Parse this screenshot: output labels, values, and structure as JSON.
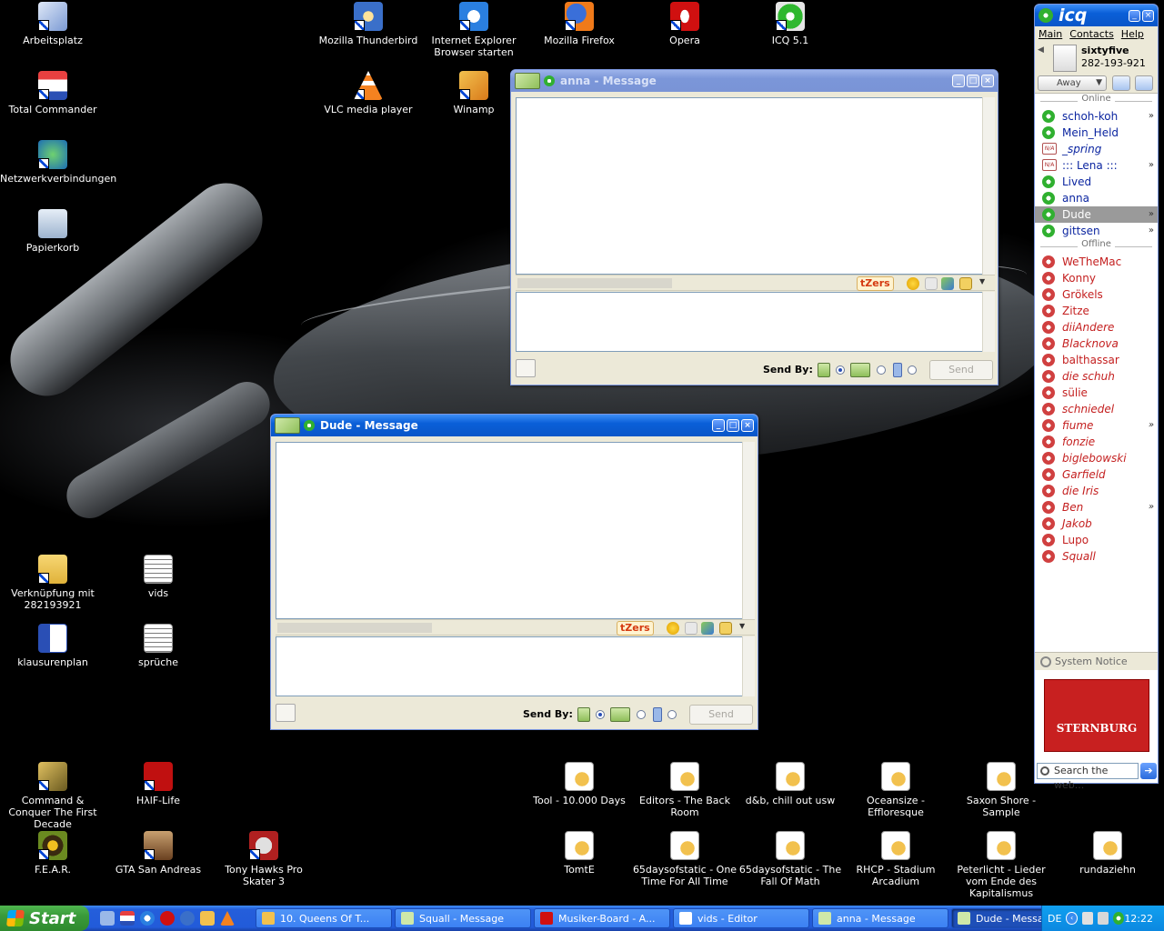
{
  "desktop": {
    "icons": [
      {
        "label": "Arbeitsplatz",
        "cls": "i-pc"
      },
      {
        "label": "Total Commander",
        "cls": "i-tc"
      },
      {
        "label": "Netzwerkverbindungen",
        "cls": "i-net"
      },
      {
        "label": "Papierkorb",
        "cls": "i-bin"
      },
      {
        "label": "Mozilla Thunderbird",
        "cls": "i-tb"
      },
      {
        "label": "Internet Explorer Browser starten",
        "cls": "i-ie"
      },
      {
        "label": "Mozilla Firefox",
        "cls": "i-ff"
      },
      {
        "label": "Opera",
        "cls": "i-op"
      },
      {
        "label": "ICQ 5.1",
        "cls": "i-icq"
      },
      {
        "label": "VLC media player",
        "cls": "i-vlc"
      },
      {
        "label": "Winamp",
        "cls": "i-wa"
      },
      {
        "label": "Verknüpfung mit 282193921",
        "cls": "i-fold"
      },
      {
        "label": "vids",
        "cls": "i-txt"
      },
      {
        "label": "klausurenplan",
        "cls": "i-word"
      },
      {
        "label": "sprüche",
        "cls": "i-txt"
      },
      {
        "label": "Command & Conquer The First Decade",
        "cls": "i-cnc"
      },
      {
        "label": "HλlF-Life",
        "cls": "i-hl"
      },
      {
        "label": "F.E.A.R.",
        "cls": "i-fear"
      },
      {
        "label": "GTA San Andreas",
        "cls": "i-gta"
      },
      {
        "label": "Tony Hawks Pro Skater 3",
        "cls": "i-thps"
      },
      {
        "label": "Tool - 10.000 Days",
        "cls": "i-mp3"
      },
      {
        "label": "Editors - The Back Room",
        "cls": "i-mp3"
      },
      {
        "label": "d&b, chill out usw",
        "cls": "i-mp3"
      },
      {
        "label": "Oceansize - Effloresque",
        "cls": "i-mp3"
      },
      {
        "label": "Saxon Shore - Sample",
        "cls": "i-mp3"
      },
      {
        "label": "TomtE",
        "cls": "i-mp3"
      },
      {
        "label": "65daysofstatic - One Time For All Time",
        "cls": "i-mp3"
      },
      {
        "label": "65daysofstatic - The Fall Of Math",
        "cls": "i-mp3"
      },
      {
        "label": "RHCP - Stadium Arcadium",
        "cls": "i-mp3"
      },
      {
        "label": "Peterlicht - Lieder vom Ende des Kapitalismus",
        "cls": "i-mp3"
      },
      {
        "label": "rundaziehn",
        "cls": "i-mp3"
      }
    ]
  },
  "anna_window": {
    "title": "anna - Message",
    "tzers_label": "tZers",
    "send_by_label": "Send By:",
    "send_label": "Send"
  },
  "dude_window": {
    "title": "Dude - Message",
    "tzers_label": "tZers",
    "send_by_label": "Send By:",
    "send_label": "Send"
  },
  "icq": {
    "title": "icq",
    "menu": {
      "main": "Main",
      "contacts": "Contacts",
      "help": "Help"
    },
    "profile": {
      "name": "sixtyfive",
      "number": "282-193-921"
    },
    "status_label": "Away",
    "online_header": "Online",
    "offline_header": "Offline",
    "online": [
      {
        "name": "schoh-koh",
        "more": true
      },
      {
        "name": "Mein_Held"
      },
      {
        "name": "_spring",
        "na": true,
        "italic": true
      },
      {
        "name": "::: Lena :::",
        "na": true,
        "more": true
      },
      {
        "name": "Lived"
      },
      {
        "name": "anna"
      },
      {
        "name": "Dude",
        "selected": true,
        "more": true
      },
      {
        "name": "gittsen",
        "more": true
      }
    ],
    "offline": [
      {
        "name": "WeTheMac"
      },
      {
        "name": "Konny"
      },
      {
        "name": "Grökels"
      },
      {
        "name": "Zitze"
      },
      {
        "name": "diiAndere",
        "italic": true
      },
      {
        "name": "Blacknova",
        "italic": true
      },
      {
        "name": "balthassar"
      },
      {
        "name": "die schuh",
        "italic": true
      },
      {
        "name": "sülie"
      },
      {
        "name": "schniedel",
        "italic": true
      },
      {
        "name": "fiume",
        "italic": true,
        "more": true
      },
      {
        "name": "fonzie",
        "italic": true
      },
      {
        "name": "biglebowski",
        "italic": true
      },
      {
        "name": "Garfield",
        "italic": true
      },
      {
        "name": "die Iris",
        "italic": true
      },
      {
        "name": "Ben",
        "italic": true,
        "more": true
      },
      {
        "name": "Jakob",
        "italic": true
      },
      {
        "name": "Lupo"
      },
      {
        "name": "Squall",
        "italic": true
      }
    ],
    "system_notice": "System Notice",
    "ad_text": "STERNBURG",
    "search_placeholder": "Search the web..."
  },
  "taskbar": {
    "start_label": "Start",
    "tasks": [
      {
        "label": "10. Queens Of T...",
        "icon": "#f2c14e",
        "active": false
      },
      {
        "label": "Squall - Message",
        "icon": "#cfe8a8",
        "active": false
      },
      {
        "label": "Musiker-Board - A...",
        "icon": "#d01010",
        "active": false
      },
      {
        "label": "vids - Editor",
        "icon": "#ffffff",
        "active": false
      },
      {
        "label": "anna - Message",
        "icon": "#cfe8a8",
        "active": false
      },
      {
        "label": "Dude - Message",
        "icon": "#cfe8a8",
        "active": true
      }
    ],
    "tray": {
      "lang": "DE",
      "clock": "12:22"
    }
  }
}
